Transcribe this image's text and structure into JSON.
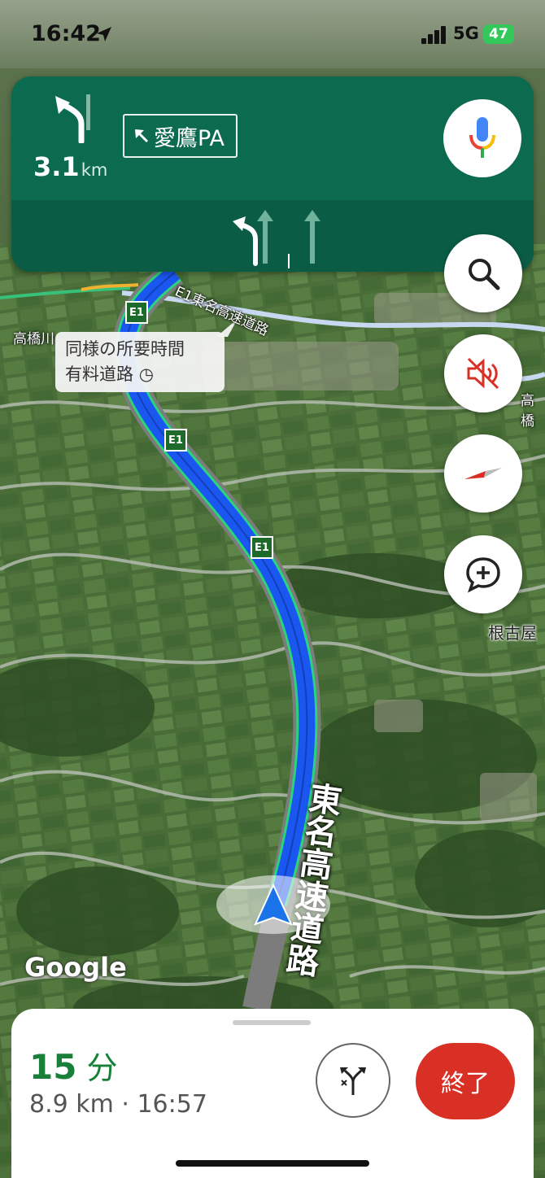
{
  "status_bar": {
    "time": "16:42",
    "network": "5G",
    "battery": "47"
  },
  "nav_banner": {
    "distance_value": "3.1",
    "distance_unit": "km",
    "sign_text": "愛鷹PA",
    "maneuver_icon": "turn-slight-left-icon",
    "mic_icon": "microphone-icon",
    "background_color": "#0c6a4f"
  },
  "map": {
    "callout_line1": "同様の所要時間",
    "callout_line2": "有料道路",
    "road_label_top": "E1東名高速道路",
    "road_label_bottom": "東名高速道路",
    "shield_label": "E1",
    "place_left": "高橋川",
    "place_right_top": "高橋",
    "place_right": "根古屋",
    "attribution": "Google",
    "route_color": "#1a56f0"
  },
  "map_buttons": {
    "search_icon": "search-icon",
    "mute_icon": "sound-off-icon",
    "compass_icon": "compass-icon",
    "report_icon": "add-report-icon"
  },
  "trip": {
    "eta_minutes": "15",
    "eta_unit": "分",
    "summary": "8.9 km · 16:57",
    "exit_label": "終了",
    "routes_icon": "alternate-routes-icon",
    "eta_color": "#188038",
    "exit_color": "#d93025"
  }
}
